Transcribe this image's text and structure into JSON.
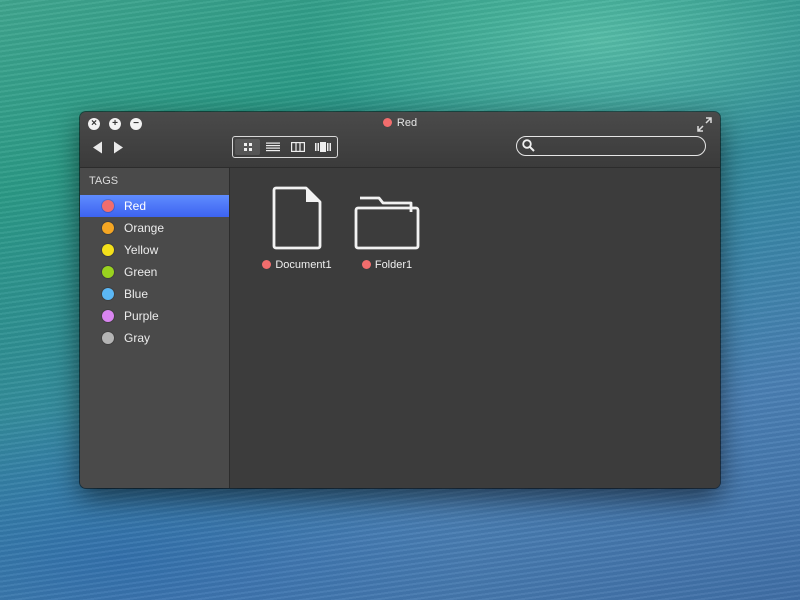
{
  "window": {
    "title": "Red",
    "title_tag_color": "#f26d6d",
    "controls": [
      "close-icon",
      "plus-icon",
      "minus-icon"
    ]
  },
  "toolbar": {
    "back_icon": "chevron-left-icon",
    "forward_icon": "chevron-right-icon",
    "view_modes": [
      "icon-view",
      "list-view",
      "column-view",
      "cover-flow-view"
    ],
    "active_view": "icon-view",
    "search": {
      "value": "",
      "placeholder": ""
    }
  },
  "sidebar": {
    "heading": "TAGS",
    "selected_color": "#4a72f5",
    "items": [
      {
        "label": "Red",
        "color": "#f26d6d",
        "selected": true
      },
      {
        "label": "Orange",
        "color": "#f5a623",
        "selected": false
      },
      {
        "label": "Yellow",
        "color": "#f3e01a",
        "selected": false
      },
      {
        "label": "Green",
        "color": "#9ad21f",
        "selected": false
      },
      {
        "label": "Blue",
        "color": "#5bb7f5",
        "selected": false
      },
      {
        "label": "Purple",
        "color": "#d985f0",
        "selected": false
      },
      {
        "label": "Gray",
        "color": "#b4b4b4",
        "selected": false
      }
    ]
  },
  "content": {
    "files": [
      {
        "name": "Document1",
        "icon": "document-icon",
        "tag_color": "#f26d6d"
      },
      {
        "name": "Folder1",
        "icon": "folder-icon",
        "tag_color": "#f26d6d"
      }
    ]
  }
}
